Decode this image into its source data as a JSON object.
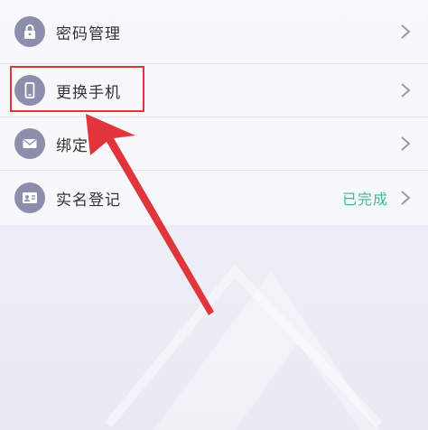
{
  "settings": {
    "items": [
      {
        "label": "密码管理",
        "icon": "lock-icon",
        "status": ""
      },
      {
        "label": "更换手机",
        "icon": "phone-icon",
        "status": ""
      },
      {
        "label": "绑定",
        "icon": "envelope-icon",
        "status": ""
      },
      {
        "label": "实名登记",
        "icon": "id-card-icon",
        "status": "已完成"
      }
    ]
  },
  "colors": {
    "icon_bg": "#8d8eab",
    "status_green": "#3fb89a",
    "annotation_red": "#e0353a"
  }
}
